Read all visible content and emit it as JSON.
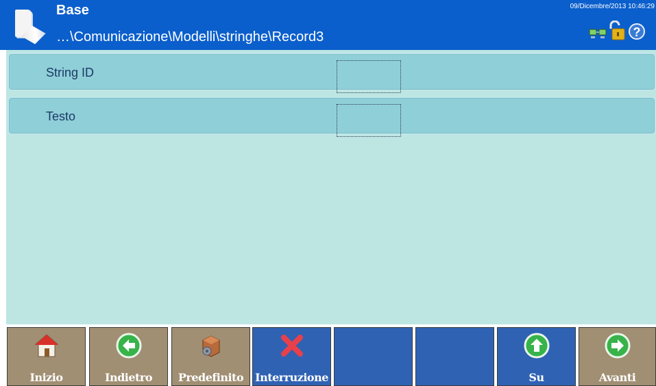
{
  "header": {
    "title": "Base",
    "path": "…\\Comunicazione\\Modelli\\stringhe\\Record3",
    "datetime": "09/Dicembre/2013 10:46:29",
    "icons": [
      "document-icon",
      "network-icon",
      "unlocked-padlock-icon",
      "help-icon"
    ],
    "help_glyph": "?"
  },
  "fields": [
    {
      "label": "String ID",
      "value": ""
    },
    {
      "label": "Testo",
      "value": ""
    }
  ],
  "softkeys": [
    {
      "label": "Inizio",
      "icon": "home-icon"
    },
    {
      "label": "Indietro",
      "icon": "arrow-left-icon"
    },
    {
      "label": "Predefinito",
      "icon": "box-gear-icon"
    },
    {
      "label": "Interruzione",
      "icon": "red-x-icon"
    },
    {
      "label": "",
      "icon": ""
    },
    {
      "label": "",
      "icon": ""
    },
    {
      "label": "Su",
      "icon": "arrow-up-icon"
    },
    {
      "label": "Avanti",
      "icon": "arrow-right-icon"
    }
  ],
  "colors": {
    "header_bg": "#0b5fcc",
    "content_bg": "#bde6e3",
    "row_bg": "#8fcfd8",
    "softkey_brown": "#a18f73",
    "softkey_blue": "#2f62b3"
  }
}
